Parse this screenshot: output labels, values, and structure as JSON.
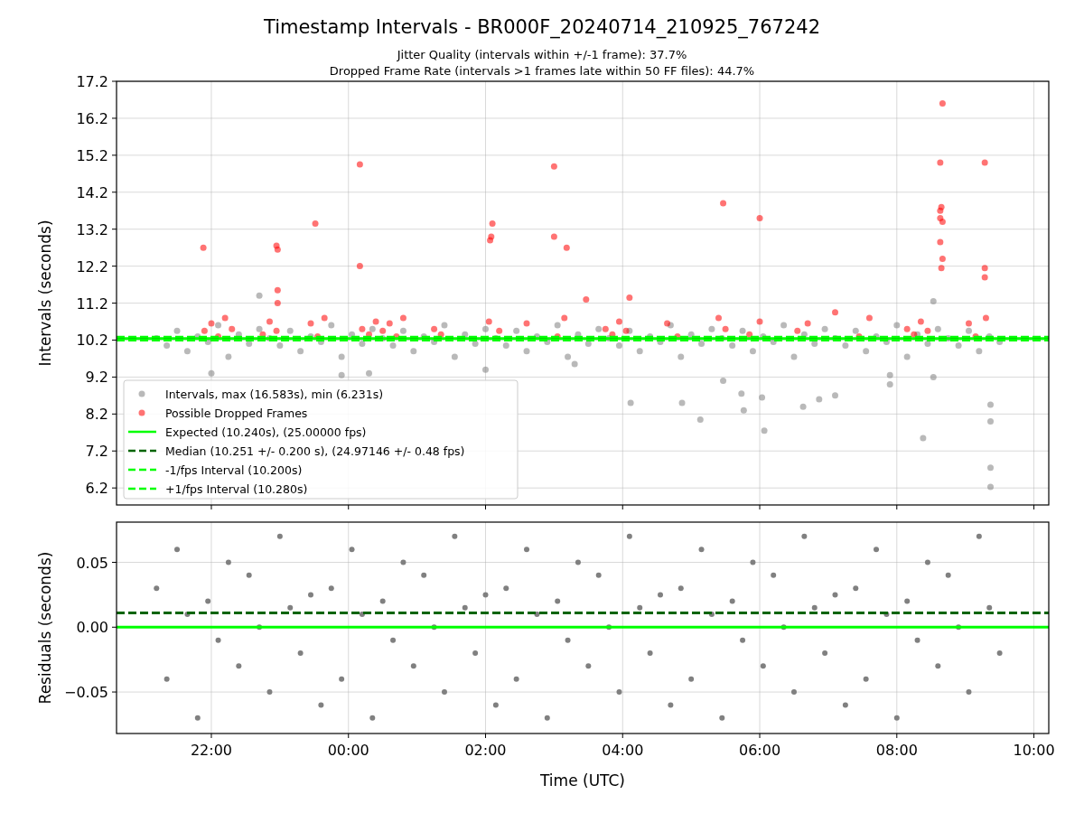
{
  "figure": {
    "title": "Timestamp Intervals - BR000F_20240714_210925_767242",
    "subtitle_lines": [
      "Jitter Quality (intervals within +/-1 frame): 37.7%",
      "Dropped Frame Rate (intervals >1 frames late within 50 FF files): 44.7%"
    ],
    "panels": [
      {
        "chart_data": {
          "type": "scatter",
          "ylabel": "Intervals (seconds)",
          "grid": true,
          "xlim": [
            "2024-07-14T20:37",
            "2024-07-15T10:13"
          ],
          "ylim": [
            5.74,
            17.2
          ],
          "yticks": [
            {
              "value": 6.2,
              "label": "6.2"
            },
            {
              "value": 7.2,
              "label": "7.2"
            },
            {
              "value": 8.2,
              "label": "8.2"
            },
            {
              "value": 9.2,
              "label": "9.2"
            },
            {
              "value": 10.2,
              "label": "10.2"
            },
            {
              "value": 11.2,
              "label": "11.2"
            },
            {
              "value": 12.2,
              "label": "12.2"
            },
            {
              "value": 13.2,
              "label": "13.2"
            },
            {
              "value": 14.2,
              "label": "14.2"
            },
            {
              "value": 15.2,
              "label": "15.2"
            },
            {
              "value": 16.2,
              "label": "16.2"
            },
            {
              "value": 17.2,
              "label": "17.2"
            }
          ],
          "series": [
            {
              "name": "Intervals, max (16.583s), min (6.231s)",
              "color": "#808080",
              "x": [
                "2024-07-14T21:12",
                "2024-07-14T21:21",
                "2024-07-14T21:30",
                "2024-07-14T21:39",
                "2024-07-14T21:48",
                "2024-07-14T21:57",
                "2024-07-14T22:06",
                "2024-07-14T22:15",
                "2024-07-14T22:24",
                "2024-07-14T22:33",
                "2024-07-14T22:42",
                "2024-07-14T22:51",
                "2024-07-14T23:00",
                "2024-07-14T23:09",
                "2024-07-14T23:18",
                "2024-07-14T23:27",
                "2024-07-14T23:36",
                "2024-07-14T23:45",
                "2024-07-14T23:54",
                "2024-07-15T00:03",
                "2024-07-15T00:12",
                "2024-07-15T00:21",
                "2024-07-15T00:30",
                "2024-07-15T00:39",
                "2024-07-15T00:48",
                "2024-07-15T00:57",
                "2024-07-15T01:06",
                "2024-07-15T01:15",
                "2024-07-15T01:24",
                "2024-07-15T01:33",
                "2024-07-15T01:42",
                "2024-07-15T01:51",
                "2024-07-15T02:00",
                "2024-07-15T02:09",
                "2024-07-15T02:18",
                "2024-07-15T02:27",
                "2024-07-15T02:36",
                "2024-07-15T02:45",
                "2024-07-15T02:54",
                "2024-07-15T03:03",
                "2024-07-15T03:12",
                "2024-07-15T03:21",
                "2024-07-15T03:30",
                "2024-07-15T03:39",
                "2024-07-15T03:48",
                "2024-07-15T03:57",
                "2024-07-15T04:06",
                "2024-07-15T04:15",
                "2024-07-15T04:24",
                "2024-07-15T04:33",
                "2024-07-15T04:42",
                "2024-07-15T04:51",
                "2024-07-15T05:00",
                "2024-07-15T05:09",
                "2024-07-15T05:18",
                "2024-07-15T05:27",
                "2024-07-15T05:36",
                "2024-07-15T05:45",
                "2024-07-15T05:54",
                "2024-07-15T06:03",
                "2024-07-15T06:12",
                "2024-07-15T06:21",
                "2024-07-15T06:30",
                "2024-07-15T06:39",
                "2024-07-15T06:48",
                "2024-07-15T06:57",
                "2024-07-15T07:06",
                "2024-07-15T07:15",
                "2024-07-15T07:24",
                "2024-07-15T07:33",
                "2024-07-15T07:42",
                "2024-07-15T07:51",
                "2024-07-15T08:00",
                "2024-07-15T08:09",
                "2024-07-15T08:18",
                "2024-07-15T08:27",
                "2024-07-15T08:36",
                "2024-07-15T08:45",
                "2024-07-15T08:54",
                "2024-07-15T09:03",
                "2024-07-15T09:12",
                "2024-07-15T09:21",
                "2024-07-15T09:30",
                "2024-07-14T22:42",
                "2024-07-15T08:32",
                "2024-07-15T04:07",
                "2024-07-15T04:52",
                "2024-07-15T05:08",
                "2024-07-15T05:28",
                "2024-07-15T05:46",
                "2024-07-15T05:44",
                "2024-07-15T06:02",
                "2024-07-15T06:04",
                "2024-07-15T06:38",
                "2024-07-15T06:52",
                "2024-07-15T07:06",
                "2024-07-15T08:23",
                "2024-07-15T08:32",
                "2024-07-15T09:22",
                "2024-07-15T09:22",
                "2024-07-15T09:22",
                "2024-07-15T09:22",
                "2024-07-14T22:00",
                "2024-07-14T23:54",
                "2024-07-15T00:18",
                "2024-07-15T02:00",
                "2024-07-15T03:18",
                "2024-07-15T07:54",
                "2024-07-15T07:54"
              ],
              "values": [
                10.25,
                10.05,
                10.45,
                9.9,
                10.3,
                10.15,
                10.6,
                9.75,
                10.35,
                10.1,
                10.5,
                10.25,
                10.05,
                10.45,
                9.9,
                10.3,
                10.15,
                10.6,
                9.75,
                10.35,
                10.1,
                10.5,
                10.25,
                10.05,
                10.45,
                9.9,
                10.3,
                10.15,
                10.6,
                9.75,
                10.35,
                10.1,
                10.5,
                10.25,
                10.05,
                10.45,
                9.9,
                10.3,
                10.15,
                10.6,
                9.75,
                10.35,
                10.1,
                10.5,
                10.25,
                10.05,
                10.45,
                9.9,
                10.3,
                10.15,
                10.6,
                9.75,
                10.35,
                10.1,
                10.5,
                10.25,
                10.05,
                10.45,
                9.9,
                10.3,
                10.15,
                10.6,
                9.75,
                10.35,
                10.1,
                10.5,
                10.25,
                10.05,
                10.45,
                9.9,
                10.3,
                10.15,
                10.6,
                9.75,
                10.35,
                10.1,
                10.5,
                10.25,
                10.05,
                10.45,
                9.9,
                10.3,
                10.15,
                11.4,
                11.25,
                8.5,
                8.5,
                8.05,
                9.1,
                8.3,
                8.75,
                8.65,
                7.75,
                8.4,
                8.6,
                8.7,
                7.55,
                9.2,
                8.45,
                8.0,
                6.75,
                6.23,
                9.3,
                9.25,
                9.3,
                9.4,
                9.55,
                9.0,
                9.25
              ]
            },
            {
              "name": "Possible Dropped Frames",
              "color": "#ff0000",
              "x": [
                "2024-07-14T21:54",
                "2024-07-14T22:00",
                "2024-07-14T22:06",
                "2024-07-14T22:12",
                "2024-07-14T22:18",
                "2024-07-14T22:45",
                "2024-07-14T22:51",
                "2024-07-14T22:57",
                "2024-07-14T23:27",
                "2024-07-14T23:33",
                "2024-07-14T23:39",
                "2024-07-15T00:12",
                "2024-07-15T00:18",
                "2024-07-15T00:24",
                "2024-07-15T00:30",
                "2024-07-15T00:36",
                "2024-07-15T00:42",
                "2024-07-15T00:48",
                "2024-07-15T01:15",
                "2024-07-15T01:21",
                "2024-07-15T02:03",
                "2024-07-15T02:12",
                "2024-07-15T02:36",
                "2024-07-15T03:03",
                "2024-07-15T03:09",
                "2024-07-15T03:45",
                "2024-07-15T03:51",
                "2024-07-15T03:57",
                "2024-07-15T04:03",
                "2024-07-15T04:39",
                "2024-07-15T04:48",
                "2024-07-15T05:24",
                "2024-07-15T05:30",
                "2024-07-15T05:51",
                "2024-07-15T06:00",
                "2024-07-15T06:33",
                "2024-07-15T06:42",
                "2024-07-15T07:27",
                "2024-07-15T07:36",
                "2024-07-15T08:09",
                "2024-07-15T08:15",
                "2024-07-15T08:21",
                "2024-07-15T08:27",
                "2024-07-15T09:03",
                "2024-07-15T09:09",
                "2024-07-15T09:18",
                "2024-07-14T21:53",
                "2024-07-14T22:57",
                "2024-07-14T22:58",
                "2024-07-14T22:58",
                "2024-07-14T22:58",
                "2024-07-14T23:31",
                "2024-07-15T00:10",
                "2024-07-15T00:10",
                "2024-07-15T02:06",
                "2024-07-15T02:05",
                "2024-07-15T02:04",
                "2024-07-15T03:00",
                "2024-07-15T03:00",
                "2024-07-15T03:11",
                "2024-07-15T03:28",
                "2024-07-15T04:06",
                "2024-07-15T05:28",
                "2024-07-15T06:00",
                "2024-07-15T07:06",
                "2024-07-15T08:40",
                "2024-07-15T08:38",
                "2024-07-15T09:17",
                "2024-07-15T08:39",
                "2024-07-15T08:38",
                "2024-07-15T08:38",
                "2024-07-15T08:40",
                "2024-07-15T08:38",
                "2024-07-15T08:40",
                "2024-07-15T08:39",
                "2024-07-15T09:17",
                "2024-07-15T09:17"
              ],
              "values": [
                10.45,
                10.65,
                10.3,
                10.8,
                10.5,
                10.35,
                10.7,
                10.45,
                10.65,
                10.3,
                10.8,
                10.5,
                10.35,
                10.7,
                10.45,
                10.65,
                10.3,
                10.8,
                10.5,
                10.35,
                10.7,
                10.45,
                10.65,
                10.3,
                10.8,
                10.5,
                10.35,
                10.7,
                10.45,
                10.65,
                10.3,
                10.8,
                10.5,
                10.35,
                10.7,
                10.45,
                10.65,
                10.3,
                10.8,
                10.5,
                10.35,
                10.7,
                10.45,
                10.65,
                10.3,
                10.8,
                12.7,
                12.75,
                12.65,
                11.55,
                11.2,
                13.35,
                14.95,
                12.2,
                13.35,
                13.0,
                12.9,
                14.9,
                13.0,
                12.7,
                11.3,
                11.35,
                13.9,
                13.5,
                10.95,
                16.6,
                15.0,
                15.0,
                13.8,
                13.7,
                13.5,
                13.4,
                12.85,
                12.4,
                12.15,
                12.15,
                11.9
              ]
            }
          ],
          "ref_lines": [
            {
              "axis": "y",
              "value": 10.24,
              "label": "Expected (10.240s), (25.00000 fps)",
              "color": "#00ff00"
            },
            {
              "axis": "y",
              "value": 10.251,
              "label": "Median (10.251 +/- 0.200 s), (24.97146 +/- 0.48 fps)",
              "color": "#006400"
            },
            {
              "axis": "y",
              "value": 10.2,
              "label": "-1/fps Interval (10.200s)",
              "color": "#00ff00"
            },
            {
              "axis": "y",
              "value": 10.28,
              "label": "+1/fps Interval (10.280s)",
              "color": "#00ff00"
            }
          ],
          "legend": true
        }
      },
      {
        "chart_data": {
          "type": "scatter",
          "xlabel": "Time (UTC)",
          "ylabel": "Residuals (seconds)",
          "grid": true,
          "xlim": [
            "2024-07-14T20:37",
            "2024-07-15T10:13"
          ],
          "ylim": [
            -0.082,
            0.081
          ],
          "xticks": [
            {
              "value": "2024-07-14T22:00",
              "label": "22:00"
            },
            {
              "value": "2024-07-15T00:00",
              "label": "00:00"
            },
            {
              "value": "2024-07-15T02:00",
              "label": "02:00"
            },
            {
              "value": "2024-07-15T04:00",
              "label": "04:00"
            },
            {
              "value": "2024-07-15T06:00",
              "label": "06:00"
            },
            {
              "value": "2024-07-15T08:00",
              "label": "08:00"
            },
            {
              "value": "2024-07-15T10:00",
              "label": "10:00"
            }
          ],
          "yticks": [
            {
              "value": -0.05,
              "label": "−0.05"
            },
            {
              "value": 0,
              "label": "0.00"
            },
            {
              "value": 0.05,
              "label": "0.05"
            }
          ],
          "series": [
            {
              "color": "#808080",
              "x": [
                "2024-07-14T21:12",
                "2024-07-14T21:21",
                "2024-07-14T21:30",
                "2024-07-14T21:39",
                "2024-07-14T21:48",
                "2024-07-14T21:57",
                "2024-07-14T22:06",
                "2024-07-14T22:15",
                "2024-07-14T22:24",
                "2024-07-14T22:33",
                "2024-07-14T22:42",
                "2024-07-14T22:51",
                "2024-07-14T23:00",
                "2024-07-14T23:09",
                "2024-07-14T23:18",
                "2024-07-14T23:27",
                "2024-07-14T23:36",
                "2024-07-14T23:45",
                "2024-07-14T23:54",
                "2024-07-15T00:03",
                "2024-07-15T00:12",
                "2024-07-15T00:21",
                "2024-07-15T00:30",
                "2024-07-15T00:39",
                "2024-07-15T00:48",
                "2024-07-15T00:57",
                "2024-07-15T01:06",
                "2024-07-15T01:15",
                "2024-07-15T01:24",
                "2024-07-15T01:33",
                "2024-07-15T01:42",
                "2024-07-15T01:51",
                "2024-07-15T02:00",
                "2024-07-15T02:09",
                "2024-07-15T02:18",
                "2024-07-15T02:27",
                "2024-07-15T02:36",
                "2024-07-15T02:45",
                "2024-07-15T02:54",
                "2024-07-15T03:03",
                "2024-07-15T03:12",
                "2024-07-15T03:21",
                "2024-07-15T03:30",
                "2024-07-15T03:39",
                "2024-07-15T03:48",
                "2024-07-15T03:57",
                "2024-07-15T04:06",
                "2024-07-15T04:15",
                "2024-07-15T04:24",
                "2024-07-15T04:33",
                "2024-07-15T04:42",
                "2024-07-15T04:51",
                "2024-07-15T05:00",
                "2024-07-15T05:09",
                "2024-07-15T05:18",
                "2024-07-15T05:27",
                "2024-07-15T05:36",
                "2024-07-15T05:45",
                "2024-07-15T05:54",
                "2024-07-15T06:03",
                "2024-07-15T06:12",
                "2024-07-15T06:21",
                "2024-07-15T06:30",
                "2024-07-15T06:39",
                "2024-07-15T06:48",
                "2024-07-15T06:57",
                "2024-07-15T07:06",
                "2024-07-15T07:15",
                "2024-07-15T07:24",
                "2024-07-15T07:33",
                "2024-07-15T07:42",
                "2024-07-15T07:51",
                "2024-07-15T08:00",
                "2024-07-15T08:09",
                "2024-07-15T08:18",
                "2024-07-15T08:27",
                "2024-07-15T08:36",
                "2024-07-15T08:45",
                "2024-07-15T08:54",
                "2024-07-15T09:03",
                "2024-07-15T09:12",
                "2024-07-15T09:21",
                "2024-07-15T09:30"
              ],
              "values": [
                0.03,
                -0.04,
                0.06,
                0.01,
                -0.07,
                0.02,
                -0.01,
                0.05,
                -0.03,
                0.04,
                0.0,
                -0.05,
                0.07,
                0.015,
                -0.02,
                0.025,
                -0.06,
                0.03,
                -0.04,
                0.06,
                0.01,
                -0.07,
                0.02,
                -0.01,
                0.05,
                -0.03,
                0.04,
                0.0,
                -0.05,
                0.07,
                0.015,
                -0.02,
                0.025,
                -0.06,
                0.03,
                -0.04,
                0.06,
                0.01,
                -0.07,
                0.02,
                -0.01,
                0.05,
                -0.03,
                0.04,
                0.0,
                -0.05,
                0.07,
                0.015,
                -0.02,
                0.025,
                -0.06,
                0.03,
                -0.04,
                0.06,
                0.01,
                -0.07,
                0.02,
                -0.01,
                0.05,
                -0.03,
                0.04,
                0.0,
                -0.05,
                0.07,
                0.015,
                -0.02,
                0.025,
                -0.06,
                0.03,
                -0.04,
                0.06,
                0.01,
                -0.07,
                0.02,
                -0.01,
                0.05,
                -0.03,
                0.04,
                0.0,
                -0.05,
                0.07,
                0.015,
                -0.02
              ]
            }
          ],
          "ref_lines": [
            {
              "axis": "y",
              "value": 0,
              "color": "#00ff00"
            },
            {
              "axis": "y",
              "value": 0.011,
              "color": "#006400"
            }
          ]
        }
      }
    ]
  }
}
